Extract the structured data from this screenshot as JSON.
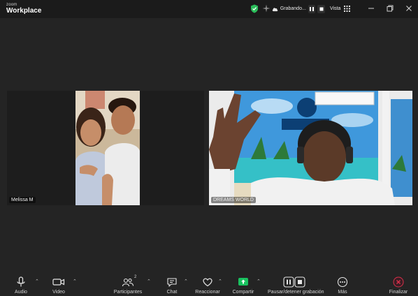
{
  "titlebar": {
    "brand_top": "zoom",
    "brand_bottom": "Workplace",
    "recording_label": "Grabando...",
    "view_label": "Vista"
  },
  "participants": [
    {
      "name": "Melissa M"
    },
    {
      "name": "DREAMS WORLD"
    }
  ],
  "toolbar": {
    "audio_label": "Audio",
    "video_label": "Video",
    "participants_label": "Participantes",
    "participants_count": "2",
    "chat_label": "Chat",
    "react_label": "Reaccionar",
    "share_label": "Compartir",
    "record_label": "Pausar/detener grabación",
    "more_label": "Más",
    "end_label": "Finalizar"
  },
  "colors": {
    "background": "#242424",
    "titlebar": "#1b1b1b",
    "share_green": "#19c15f",
    "shield_green": "#2bbd5a",
    "end_red": "#d9304a"
  }
}
